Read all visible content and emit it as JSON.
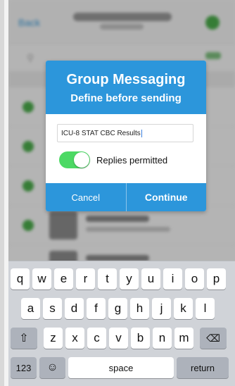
{
  "background": {
    "nav_back_label": "Back",
    "rows_count_hint": ""
  },
  "modal": {
    "title": "Group Messaging",
    "subtitle": "Define before sending",
    "input_value": "ICU-8 STAT CBC Results",
    "toggle_label": "Replies permitted",
    "toggle_on": true,
    "cancel_label": "Cancel",
    "continue_label": "Continue"
  },
  "keyboard": {
    "row1": [
      "q",
      "w",
      "e",
      "r",
      "t",
      "y",
      "u",
      "i",
      "o",
      "p"
    ],
    "row2": [
      "a",
      "s",
      "d",
      "f",
      "g",
      "h",
      "j",
      "k",
      "l"
    ],
    "row3": [
      "z",
      "x",
      "c",
      "v",
      "b",
      "n",
      "m"
    ],
    "numbers_label": "123",
    "space_label": "space",
    "return_label": "return"
  },
  "colors": {
    "accent": "#2c96db",
    "toggle_on": "#4cd964"
  }
}
